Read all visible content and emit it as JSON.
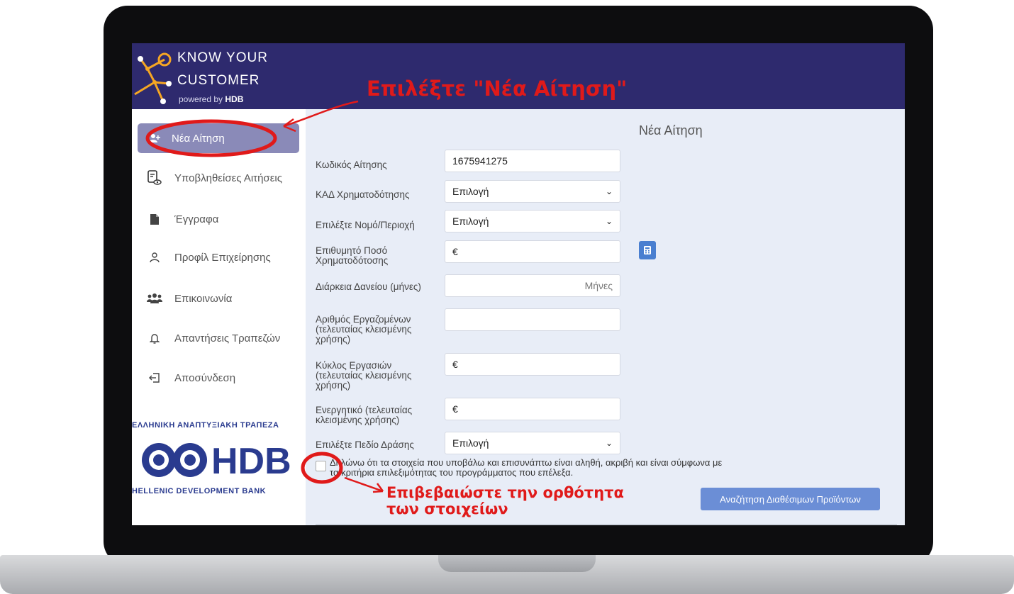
{
  "brand": {
    "line1": "KNOW YOUR",
    "line2": "CUSTOMER",
    "powered_prefix": "powered by",
    "powered_brand": "HDB"
  },
  "sidebar": {
    "items": [
      {
        "label": "Νέα Αίτηση",
        "icon": "user-plus-icon",
        "active": true
      },
      {
        "label": "Υποβληθείσες Αιτήσεις",
        "icon": "document-eye-icon"
      },
      {
        "label": "Έγγραφα",
        "icon": "file-icon"
      },
      {
        "label": "Προφίλ Επιχείρησης",
        "icon": "user-icon"
      },
      {
        "label": "Επικοινωνία",
        "icon": "users-icon"
      },
      {
        "label": "Απαντήσεις Τραπεζών",
        "icon": "bell-icon"
      },
      {
        "label": "Αποσύνδεση",
        "icon": "logout-icon"
      }
    ],
    "bank": {
      "greek_name": "ΕΛΛΗΝΙΚΗ ΑΝΑΠΤΥΞΙΑΚΗ ΤΡΑΠΕΖΑ",
      "logo_text": "HDB",
      "english_name": "HELLENIC DEVELOPMENT BANK"
    }
  },
  "main": {
    "title": "Νέα Αίτηση",
    "fields": {
      "code_label": "Κωδικός Αίτησης",
      "code_value": "1675941275",
      "kad_label": "ΚΑΔ Χρηματοδότησης",
      "kad_value": "Επιλογή",
      "region_label": "Επιλέξτε Νομό/Περιοχή",
      "region_value": "Επιλογή",
      "amount_label": "Επιθυμητό Ποσό Χρηματοδότοσης",
      "amount_prefix": "€",
      "duration_label": "Διάρκεια Δανείου (μήνες)",
      "duration_suffix": "Μήνες",
      "employees_label": "Αριθμός Εργαζομένων (τελευταίας κλεισμένης χρήσης)",
      "turnover_label": "Κύκλος Εργασιών (τελευταίας κλεισμένης χρήσης)",
      "turnover_prefix": "€",
      "assets_label": "Ενεργητικό (τελευταίας κλεισμένης χρήσης)",
      "assets_prefix": "€",
      "field_label": "Επιλέξτε Πεδίο Δράσης",
      "field_value": "Επιλογή"
    },
    "declaration": "Δηλώνω ότι τα στοιχεία που υποβάλω και επισυνάπτω είναι αληθή, ακριβή και είναι σύμφωνα με τα κριτήρια επιλεξιμότητας του προγράμματος που επέλεξα.",
    "search_button": "Αναζήτηση Διαθέσιμων Προϊόντων"
  },
  "annotations": {
    "select_new": "Επιλέξτε \"Νέα Αίτηση\"",
    "confirm_line1": "Επιβεβαιώστε την ορθότητα",
    "confirm_line2": "των στοιχείων",
    "color": "#e01a1a"
  }
}
